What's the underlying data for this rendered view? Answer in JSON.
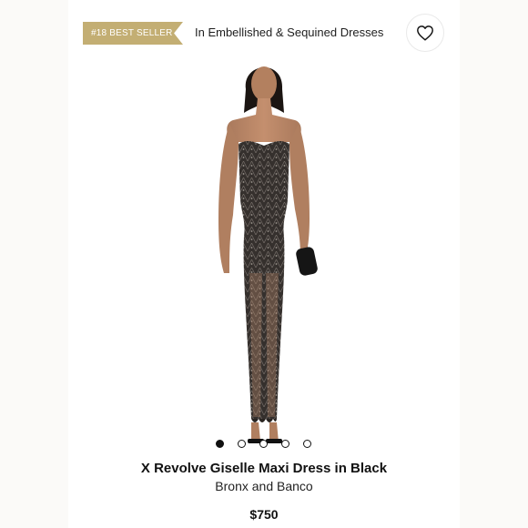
{
  "badge": {
    "text": "#18 BEST SELLER",
    "color": "#c3ae73"
  },
  "category": {
    "text": "In Embellished & Sequined Dresses"
  },
  "wishlist": {
    "icon": "heart-icon"
  },
  "image": {
    "alt": "Model wearing black sequined strapless maxi dress"
  },
  "carousel": {
    "count": 5,
    "active_index": 0
  },
  "product": {
    "title": "X Revolve Giselle Maxi Dress in Black",
    "brand": "Bronx and Banco",
    "price": "$750"
  }
}
